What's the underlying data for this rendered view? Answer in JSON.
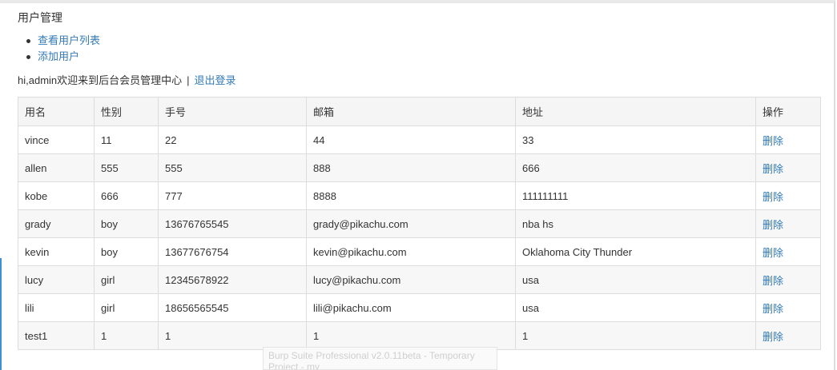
{
  "page": {
    "title": "用户管理",
    "menu": [
      {
        "label": "查看用户列表"
      },
      {
        "label": "添加用户"
      }
    ],
    "welcome_text": "hi,admin欢迎来到后台会员管理中心",
    "separator": "|",
    "logout_label": "退出登录"
  },
  "table": {
    "headers": [
      "用名",
      "性别",
      "手号",
      "邮箱",
      "地址",
      "操作"
    ],
    "rows": [
      {
        "name": "vince",
        "gender": "11",
        "phone": "22",
        "email": "44",
        "address": "33",
        "action": "删除"
      },
      {
        "name": "allen",
        "gender": "555",
        "phone": "555",
        "email": "888",
        "address": "666",
        "action": "删除"
      },
      {
        "name": "kobe",
        "gender": "666",
        "phone": "777",
        "email": "8888",
        "address": "111111111",
        "action": "删除"
      },
      {
        "name": "grady",
        "gender": "boy",
        "phone": "13676765545",
        "email": "grady@pikachu.com",
        "address": "nba hs",
        "action": "删除"
      },
      {
        "name": "kevin",
        "gender": "boy",
        "phone": "13677676754",
        "email": "kevin@pikachu.com",
        "address": "Oklahoma City Thunder",
        "action": "删除"
      },
      {
        "name": "lucy",
        "gender": "girl",
        "phone": "12345678922",
        "email": "lucy@pikachu.com",
        "address": "usa",
        "action": "删除"
      },
      {
        "name": "lili",
        "gender": "girl",
        "phone": "18656565545",
        "email": "lili@pikachu.com",
        "address": "usa",
        "action": "删除"
      },
      {
        "name": "test1",
        "gender": "1",
        "phone": "1",
        "email": "1",
        "address": "1",
        "action": "删除"
      }
    ]
  },
  "watermark": {
    "line1": "Burp Suite Professional v2.0.11beta - Temporary",
    "line2": "Project - my"
  },
  "colors": {
    "link": "#337ab7",
    "text": "#333333",
    "border": "#dddddd",
    "header_bg": "#f5f5f5",
    "stripe_bg": "#f7f7f7"
  }
}
